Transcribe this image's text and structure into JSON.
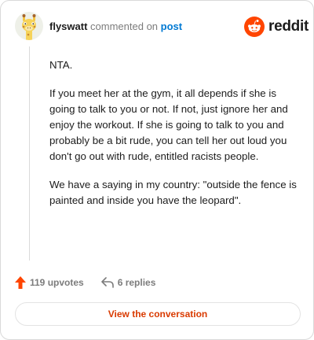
{
  "header": {
    "username": "flyswatt",
    "action_text": "commented on",
    "post_link": "post",
    "avatar_icon": "giraffe-avatar-icon",
    "logo_icon": "reddit-alien-icon",
    "logo_text": "reddit"
  },
  "comment": {
    "paragraphs": [
      "NTA.",
      "If you meet her at the gym, it all depends if she is going to talk to you or not. If not, just ignore her and enjoy the workout. If she is going to talk to you and probably be a bit rude, you can tell her out loud you don't go out with rude, entitled racists people.",
      "We have a saying in my country: \"outside the fence is painted and inside you have the leopard\"."
    ]
  },
  "actions": {
    "upvotes_label": "119 upvotes",
    "upvote_icon": "upvote-arrow-icon",
    "replies_label": "6 replies",
    "reply_icon": "reply-arrow-icon"
  },
  "cta": {
    "label": "View the conversation"
  },
  "colors": {
    "brand": "#ff4500",
    "link": "#0079d3",
    "cta": "#d93a00"
  }
}
